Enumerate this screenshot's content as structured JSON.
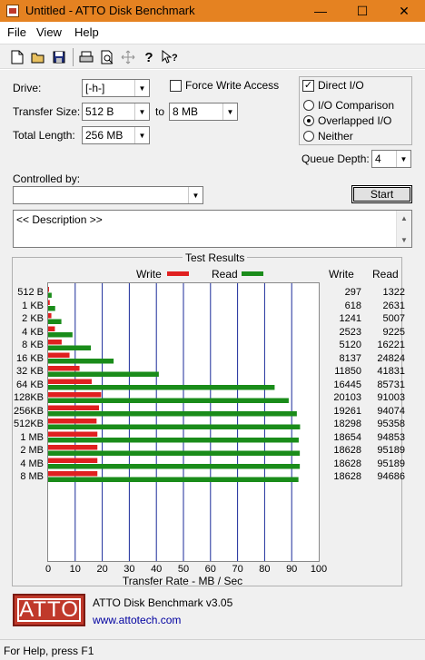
{
  "window": {
    "title": "Untitled - ATTO Disk Benchmark",
    "controls": {
      "minimize": "—",
      "maximize": "☐",
      "close": "✕"
    }
  },
  "menu": [
    "File",
    "View",
    "Help"
  ],
  "toolbar": {
    "icons": [
      "new-icon",
      "open-icon",
      "save-icon",
      "print-icon",
      "print-preview-icon",
      "move-icon",
      "help-icon",
      "context-help-icon"
    ]
  },
  "form": {
    "drive_label": "Drive:",
    "drive_value": "[-h-]",
    "transfer_size_label": "Transfer Size:",
    "transfer_from": "512 B",
    "to_label": "to",
    "transfer_to": "8 MB",
    "total_length_label": "Total Length:",
    "total_length_value": "256 MB",
    "force_write_label": "Force Write Access",
    "force_write_checked": false,
    "direct_io_label": "Direct I/O",
    "direct_io_checked": true,
    "io_comparison_label": "I/O Comparison",
    "overlapped_io_label": "Overlapped I/O",
    "neither_label": "Neither",
    "selected_mode": "Overlapped I/O",
    "queue_depth_label": "Queue Depth:",
    "queue_depth_value": "4",
    "controlled_by_label": "Controlled by:",
    "controlled_by_value": "",
    "start_label": "Start",
    "description_text": "<< Description >>"
  },
  "results": {
    "title": "Test Results",
    "legend_write": "Write",
    "legend_read": "Read",
    "col_write": "Write",
    "col_read": "Read",
    "write_color": "#e02020",
    "read_color": "#1a8c1a",
    "xlabel": "Transfer Rate - MB / Sec"
  },
  "chart_data": {
    "type": "bar",
    "orientation": "horizontal",
    "title": "Test Results",
    "xlabel": "Transfer Rate - MB / Sec",
    "xlim": [
      0,
      100
    ],
    "xticks": [
      "0",
      "10",
      "20",
      "30",
      "40",
      "50",
      "60",
      "70",
      "80",
      "90",
      "100"
    ],
    "categories": [
      "512 B",
      "1 KB",
      "2 KB",
      "4 KB",
      "8 KB",
      "16 KB",
      "32 KB",
      "64 KB",
      "128KB",
      "256KB",
      "512KB",
      "1 MB",
      "2 MB",
      "4 MB",
      "8 MB"
    ],
    "series": [
      {
        "name": "Write",
        "values": [
          0.3,
          0.6,
          1.2,
          2.5,
          5.0,
          7.9,
          11.6,
          16.1,
          19.6,
          18.8,
          17.9,
          18.2,
          18.2,
          18.2,
          18.2
        ]
      },
      {
        "name": "Read",
        "values": [
          1.3,
          2.6,
          4.9,
          9.0,
          15.8,
          24.2,
          40.9,
          83.7,
          88.9,
          91.9,
          93.1,
          92.6,
          93.0,
          93.0,
          92.5
        ]
      }
    ],
    "write_numbers": [
      "297",
      "618",
      "1241",
      "2523",
      "5120",
      "8137",
      "11850",
      "16445",
      "20103",
      "19261",
      "18298",
      "18654",
      "18628",
      "18628",
      "18628"
    ],
    "read_numbers": [
      "1322",
      "2631",
      "5007",
      "9225",
      "16221",
      "24824",
      "41831",
      "85731",
      "91003",
      "94074",
      "95358",
      "94853",
      "95189",
      "95189",
      "94686"
    ]
  },
  "footer": {
    "logo_text": "ATTO",
    "product": "ATTO Disk Benchmark v3.05",
    "url": "www.attotech.com"
  },
  "status": "For Help, press F1"
}
